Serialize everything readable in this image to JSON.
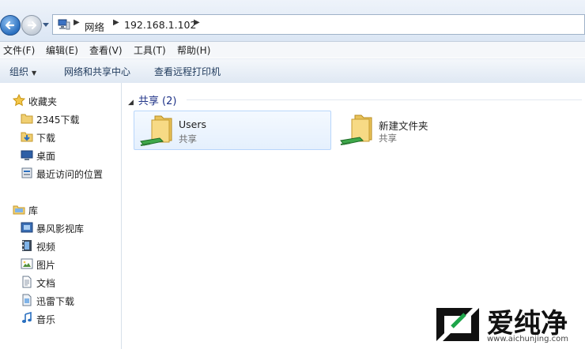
{
  "address": {
    "crumbs": [
      "网络",
      "192.168.1.102"
    ]
  },
  "menu": [
    "文件(F)",
    "编辑(E)",
    "查看(V)",
    "工具(T)",
    "帮助(H)"
  ],
  "toolbar": {
    "organize": "组织",
    "network_center": "网络和共享中心",
    "remote_printers": "查看远程打印机"
  },
  "nav": {
    "favorites": {
      "title": "收藏夹",
      "items": [
        "2345下载",
        "下载",
        "桌面",
        "最近访问的位置"
      ]
    },
    "library": {
      "title": "库",
      "items": [
        "暴风影视库",
        "视频",
        "图片",
        "文档",
        "迅雷下载",
        "音乐"
      ]
    }
  },
  "group": {
    "title": "共享 (2)",
    "items": [
      {
        "name": "Users",
        "type": "共享"
      },
      {
        "name": "新建文件夹",
        "type": "共享"
      }
    ]
  },
  "watermark": {
    "brand": "爱纯净",
    "url": "www.aichunjing.com"
  },
  "colors": {
    "accent": "#1e3287",
    "selection": "#e5f0fd"
  }
}
